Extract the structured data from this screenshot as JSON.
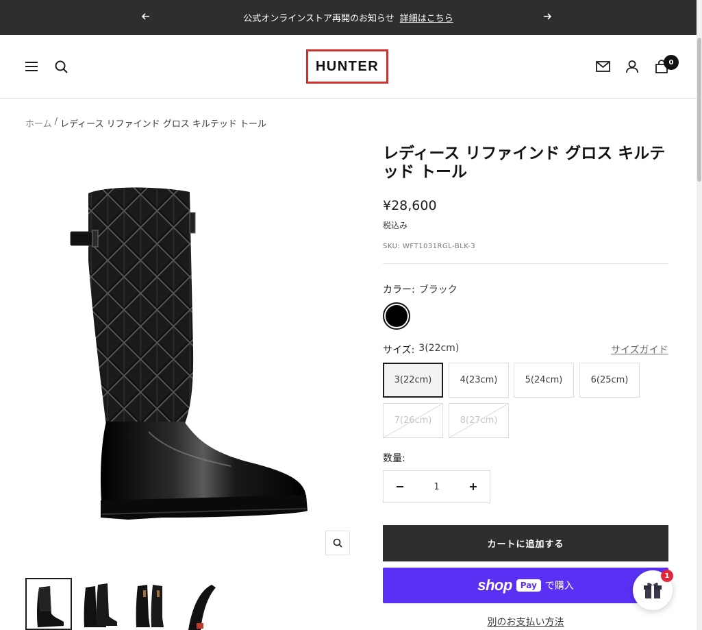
{
  "announcement": {
    "text": "公式オンラインストア再開のお知らせ",
    "link": "詳細はこちら"
  },
  "header": {
    "logo": "HUNTER",
    "cart_count": "0"
  },
  "breadcrumb": {
    "home": "ホーム",
    "separator": "/",
    "current": "レディース リファインド グロス キルテッド トール"
  },
  "product": {
    "title": "レディース リファインド グロス キルテッド トール",
    "price": "¥28,600",
    "tax_note": "税込み",
    "sku": "SKU: WFT1031RGL-BLK-3",
    "color_label": "カラー:",
    "color_value": "ブラック",
    "size_label": "サイズ:",
    "size_value": "3(22cm)",
    "size_guide": "サイズガイド",
    "sizes": [
      {
        "label": "3(22cm)",
        "state": "selected"
      },
      {
        "label": "4(23cm)",
        "state": "available"
      },
      {
        "label": "5(24cm)",
        "state": "available"
      },
      {
        "label": "6(25cm)",
        "state": "available"
      },
      {
        "label": "7(26cm)",
        "state": "disabled"
      },
      {
        "label": "8(27cm)",
        "state": "disabled"
      }
    ],
    "quantity_label": "数量:",
    "quantity": "1",
    "add_to_cart": "カートに追加する",
    "shop_pay": {
      "shop": "shop",
      "pay": "Pay",
      "buy": "で購入"
    },
    "other_payment": "別のお支払い方法"
  },
  "gift_badge": "1",
  "colors": {
    "announce_bg": "#2e2e2e",
    "logo_border": "#d0312d",
    "shop_pay": "#5a31f4",
    "badge": "#e0283a"
  }
}
